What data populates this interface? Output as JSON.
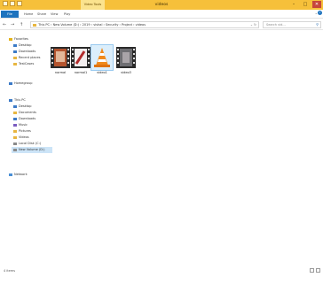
{
  "window": {
    "title": "videos",
    "context_tab": "Video Tools",
    "minimize": "–",
    "maximize": "□",
    "close": "✕"
  },
  "ribbon": {
    "tabs": [
      "File",
      "Home",
      "Share",
      "View",
      "Play"
    ],
    "expand": "⌄",
    "help": "?"
  },
  "address": {
    "back": "←",
    "forward": "→",
    "up": "↑",
    "crumbs": "This PC › New Volume (D:) › 2019 › vishal › Security › Project › videos",
    "refresh": "⌄ ↻",
    "search_placeholder": "Search vid..."
  },
  "sidebar": {
    "favorites": "Favorites",
    "fav_items": [
      "Desktop",
      "Downloads",
      "Recent places",
      "TestCases"
    ],
    "homegroup": "Homegroup",
    "thispc": "This PC",
    "pc_items": [
      "Desktop",
      "Documents",
      "Downloads",
      "Music",
      "Pictures",
      "Videos",
      "Local Disk (C:)",
      "New Volume (D:)"
    ],
    "network": "Network"
  },
  "files": [
    {
      "name": "normal",
      "icon": "video-thumbnail-icon"
    },
    {
      "name": "normal1",
      "icon": "video-thumbnail-icon"
    },
    {
      "name": "video1",
      "icon": "vlc-cone-icon"
    },
    {
      "name": "video3",
      "icon": "video-thumbnail-icon"
    }
  ],
  "status": {
    "count": "4 items"
  }
}
